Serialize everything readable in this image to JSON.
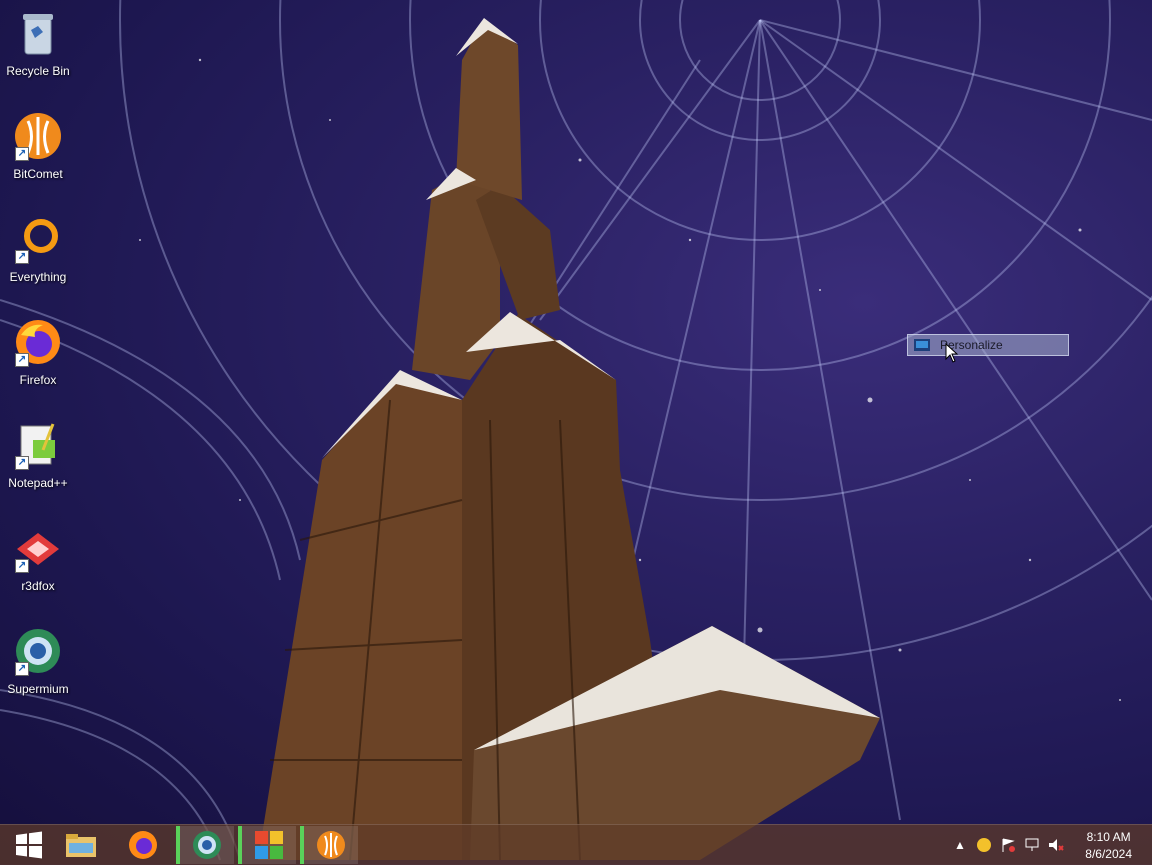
{
  "desktop": {
    "icons": [
      {
        "label": "Recycle Bin",
        "icon": "recycle-bin-icon"
      },
      {
        "label": "BitComet",
        "icon": "bitcomet-icon"
      },
      {
        "label": "Everything",
        "icon": "everything-icon"
      },
      {
        "label": "Firefox",
        "icon": "firefox-icon"
      },
      {
        "label": "Notepad++",
        "icon": "notepadpp-icon"
      },
      {
        "label": "r3dfox",
        "icon": "r3dfox-icon"
      },
      {
        "label": "Supermium",
        "icon": "supermium-icon"
      }
    ]
  },
  "context_menu": {
    "items": [
      {
        "label": "Personalize",
        "icon": "personalize-icon"
      }
    ]
  },
  "taskbar": {
    "start_icon": "windows-start-icon",
    "pinned": [
      {
        "name": "file-explorer",
        "icon": "folder-icon"
      },
      {
        "name": "firefox",
        "icon": "firefox-icon"
      },
      {
        "name": "supermium",
        "icon": "supermium-icon"
      },
      {
        "name": "app",
        "icon": "colorful-app-icon"
      },
      {
        "name": "bitcomet",
        "icon": "bitcomet-icon"
      }
    ],
    "tray": {
      "time": "8:10 AM",
      "date": "8/6/2024"
    }
  },
  "colors": {
    "wallpaper_base": "#221a5a",
    "taskbar": "#5f3c28",
    "active_indicator": "#5ad15a"
  }
}
